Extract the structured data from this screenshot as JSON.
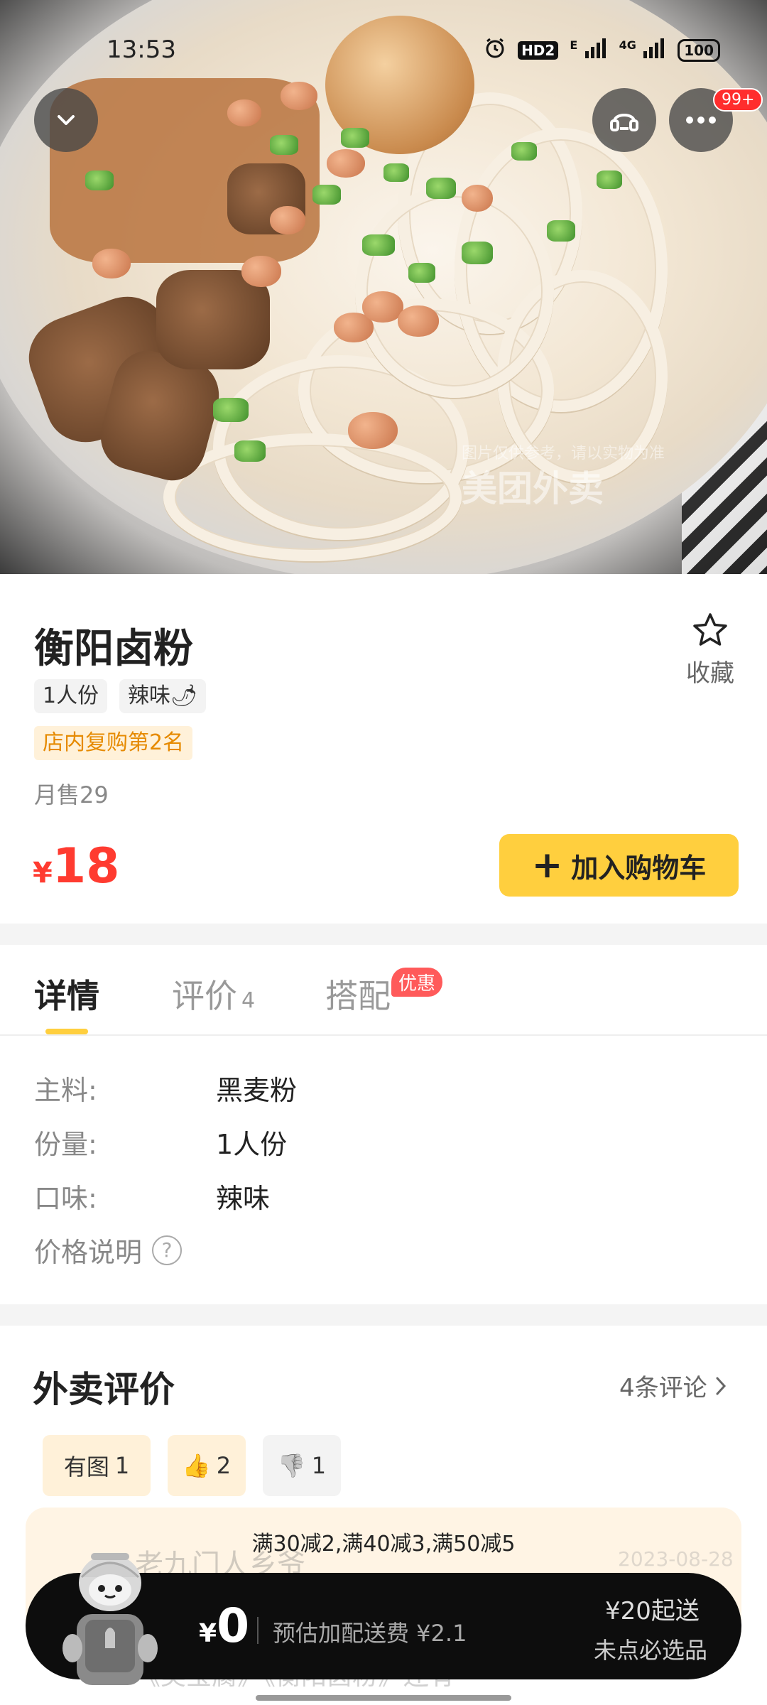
{
  "status_bar": {
    "time": "13:53",
    "network_label": "HD2",
    "signal_1": "E",
    "signal_2": "4G",
    "battery": "100"
  },
  "hero": {
    "watermark": "美团外卖",
    "watermark_note": "图片仅供参考，请以实物为准"
  },
  "header": {
    "notification_badge": "99+"
  },
  "product": {
    "name": "衡阳卤粉",
    "tags": [
      "1人份",
      "辣味🌶"
    ],
    "rank_tag": "店内复购第2名",
    "monthly_sales": "月售29",
    "currency": "¥",
    "price": "18",
    "add_to_cart": "加入购物车",
    "favorite_label": "收藏"
  },
  "tabs": {
    "items": [
      {
        "label": "详情",
        "count": ""
      },
      {
        "label": "评价",
        "count": "4"
      },
      {
        "label": "搭配",
        "count": ""
      }
    ],
    "promo_badge": "优惠"
  },
  "details": {
    "rows": [
      {
        "key": "主料:",
        "value": "黑麦粉"
      },
      {
        "key": "份量:",
        "value": "1人份"
      },
      {
        "key": "口味:",
        "value": "辣味"
      }
    ],
    "price_note": "价格说明"
  },
  "reviews": {
    "title": "外卖评价",
    "count_link": "4条评论",
    "filters": [
      {
        "label": "有图",
        "count": "1"
      },
      {
        "label": "👍",
        "count": "2"
      },
      {
        "label": "👎",
        "count": "1"
      }
    ],
    "ghost_name": "老九门人乡爷",
    "ghost_date": "2023-08-28",
    "ghost_text": "《美宝腐》《衡阳卤粉》还有"
  },
  "promo_text": "满30减2,满40减3,满50减5",
  "cart": {
    "currency": "¥",
    "amount": "0",
    "delivery_fee": "预估加配送费 ¥2.1",
    "min_order": "¥20起送",
    "must_pick": "未点必选品"
  }
}
